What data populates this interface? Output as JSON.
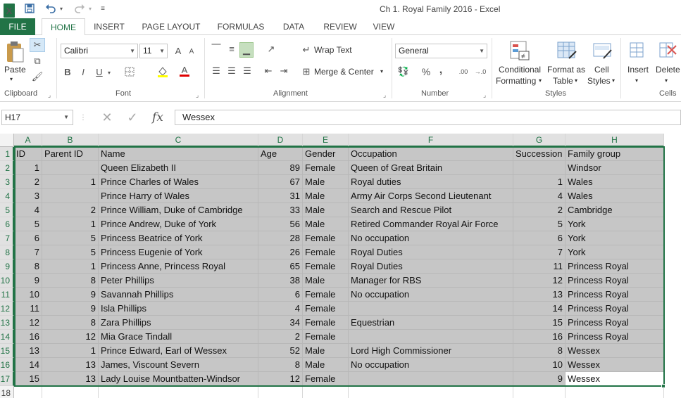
{
  "window": {
    "title": "Ch 1. Royal Family 2016 - Excel",
    "logo": "X"
  },
  "quick_access": {
    "save_icon": "save-icon",
    "undo_icon": "undo-icon",
    "redo_icon": "redo-icon",
    "customize_icon": "customize-icon"
  },
  "tabs": [
    {
      "label": "FILE"
    },
    {
      "label": "HOME"
    },
    {
      "label": "INSERT"
    },
    {
      "label": "PAGE LAYOUT"
    },
    {
      "label": "FORMULAS"
    },
    {
      "label": "DATA"
    },
    {
      "label": "REVIEW"
    },
    {
      "label": "VIEW"
    }
  ],
  "ribbon": {
    "clipboard": {
      "paste": "Paste",
      "label": "Clipboard"
    },
    "font": {
      "name": "Calibri",
      "size": "11",
      "grow": "A",
      "shrink": "A",
      "bold": "B",
      "italic": "I",
      "underline": "U",
      "color_letter": "A",
      "label": "Font"
    },
    "alignment": {
      "wrap": "Wrap Text",
      "merge": "Merge & Center",
      "label": "Alignment"
    },
    "number": {
      "format": "General",
      "percent": "%",
      "comma": ",",
      "inc_dec": ".00",
      "label": "Number"
    },
    "styles": {
      "cond_1": "Conditional",
      "cond_2": "Formatting",
      "table_1": "Format as",
      "table_2": "Table",
      "cell_1": "Cell",
      "cell_2": "Styles",
      "label": "Styles"
    },
    "cells": {
      "insert": "Insert",
      "delete": "Delete",
      "label": "Cells"
    }
  },
  "formula_bar": {
    "name_box": "H17",
    "fx": "fx",
    "value": "Wessex"
  },
  "sheet": {
    "columns": [
      "A",
      "B",
      "C",
      "D",
      "E",
      "F",
      "G",
      "H"
    ],
    "row_numbers": [
      "1",
      "2",
      "3",
      "4",
      "5",
      "6",
      "7",
      "8",
      "9",
      "10",
      "11",
      "12",
      "13",
      "14",
      "15",
      "16",
      "17",
      "18"
    ],
    "header": [
      "ID",
      "Parent ID",
      "Name",
      "Age",
      "Gender",
      "Occupation",
      "Succession",
      "Family group"
    ],
    "rows": [
      [
        "1",
        "",
        "Queen Elizabeth II",
        "89",
        "Female",
        "Queen of Great Britain",
        "",
        "Windsor"
      ],
      [
        "2",
        "1",
        "Prince Charles of Wales",
        "67",
        "Male",
        "Royal duties",
        "1",
        "Wales"
      ],
      [
        "3",
        "",
        "Prince Harry of Wales",
        "31",
        "Male",
        "Army Air Corps Second Lieutenant",
        "4",
        "Wales"
      ],
      [
        "4",
        "2",
        "Prince William, Duke of Cambridge",
        "33",
        "Male",
        "Search and Rescue Pilot",
        "2",
        "Cambridge"
      ],
      [
        "5",
        "1",
        "Prince Andrew, Duke of York",
        "56",
        "Male",
        "Retired Commander Royal Air Force",
        "5",
        "York"
      ],
      [
        "6",
        "5",
        "Princess Beatrice of York",
        "28",
        "Female",
        "No occupation",
        "6",
        "York"
      ],
      [
        "7",
        "5",
        "Princess Eugenie of York",
        "26",
        "Female",
        "Royal Duties",
        "7",
        "York"
      ],
      [
        "8",
        "1",
        "Princess Anne, Princess Royal",
        "65",
        "Female",
        "Royal Duties",
        "11",
        "Princess Royal"
      ],
      [
        "9",
        "8",
        "Peter Phillips",
        "38",
        "Male",
        "Manager for RBS",
        "12",
        "Princess Royal"
      ],
      [
        "10",
        "9",
        "Savannah Phillips",
        "6",
        "Female",
        "No occupation",
        "13",
        "Princess Royal"
      ],
      [
        "11",
        "9",
        "Isla Phillips",
        "4",
        "Female",
        "",
        "14",
        "Princess Royal"
      ],
      [
        "12",
        "8",
        "Zara Phillips",
        "34",
        "Female",
        "Equestrian",
        "15",
        "Princess Royal"
      ],
      [
        "16",
        "12",
        "Mia Grace Tindall",
        "2",
        "Female",
        "",
        "16",
        "Princess Royal"
      ],
      [
        "13",
        "1",
        "Prince Edward, Earl of Wessex",
        "52",
        "Male",
        "Lord High Commissioner",
        "8",
        "Wessex"
      ],
      [
        "14",
        "13",
        "James, Viscount Severn",
        "8",
        "Male",
        "No occupation",
        "10",
        "Wessex"
      ],
      [
        "15",
        "13",
        "Lady Louise Mountbatten-Windsor",
        "12",
        "Female",
        "",
        "9",
        "Wessex"
      ]
    ]
  },
  "colors": {
    "accent": "#217346",
    "selection": "#c6c6c6"
  }
}
